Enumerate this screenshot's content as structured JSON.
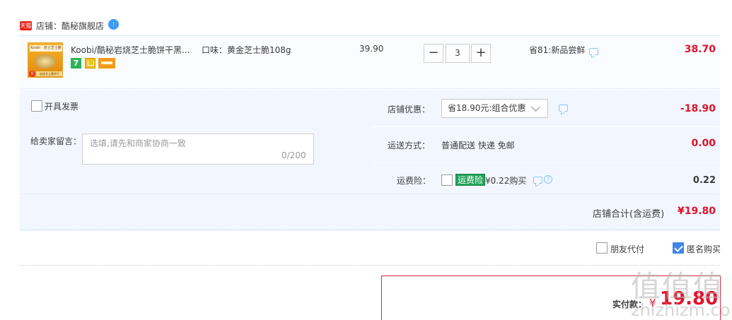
{
  "shop": {
    "badge": "天猫",
    "label": "店铺：酷秘旗舰店",
    "chat_icon": "wangwang-icon"
  },
  "item": {
    "title": "Koobi/酷秘岩烧芝士脆饼干黑...",
    "sku": "口味：黄金芝士脆108g",
    "unit_price": "39.90",
    "quantity": "3",
    "minus_label": "−",
    "plus_label": "+",
    "promo": "省81:新品尝鲜",
    "total": "38.70",
    "thumb": {
      "brand": "Koobi · 岩士芝士脆",
      "corner": "0",
      "strip": "岩烧芝士脆饼干"
    },
    "service_badges": [
      "7",
      "shield-badge-icon",
      "card-badge-icon"
    ]
  },
  "invoice": {
    "label": "开具发票",
    "checked": false
  },
  "message": {
    "label": "给卖家留言：",
    "placeholder": "选填,请先和商家协商一致",
    "counter": "0/200"
  },
  "coupon": {
    "label": "店铺优惠：",
    "selected": "省18.90元:组合优惠",
    "amount": "-18.90"
  },
  "shipping": {
    "label": "运送方式：",
    "method": "普通配送 快递 免邮",
    "fee": "0.00"
  },
  "insurance": {
    "label": "运费险：",
    "tag": "运费险",
    "text": "¥0.22购买",
    "qmark": "?",
    "fee": "0.22"
  },
  "shop_total": {
    "label": "店铺合计(含运费)",
    "amount": "¥19.80"
  },
  "order_options": {
    "friend_pay": {
      "label": "朋友代付",
      "checked": false
    },
    "anonymous": {
      "label": "匿名购买",
      "checked": true
    }
  },
  "payment": {
    "label": "实付款：",
    "currency": "¥",
    "amount": "19.80"
  },
  "watermark": {
    "big": "值值值",
    "small": "zhizhizm.com"
  },
  "colors": {
    "price_red": "#e1122a",
    "panel_blue": "#f2f7ff",
    "check_blue": "#3f86e6",
    "insurance_green": "#24a15a"
  }
}
